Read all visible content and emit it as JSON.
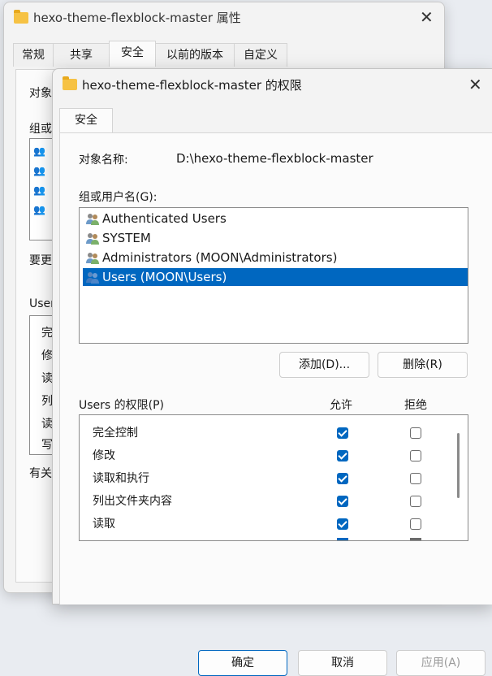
{
  "back_window": {
    "title": "hexo-theme-flexblock-master 属性",
    "tabs": [
      "常规",
      "共享",
      "安全",
      "以前的版本",
      "自定义"
    ],
    "active_tab": 2,
    "fragments": [
      "对象",
      "组或",
      "要更",
      "User",
      "完",
      "修",
      "读",
      "列",
      "读",
      "写",
      "有关"
    ]
  },
  "dialog": {
    "title": "hexo-theme-flexblock-master 的权限",
    "tab": "安全",
    "object_label": "对象名称:",
    "object_value": "D:\\hexo-theme-flexblock-master",
    "group_label": "组或用户名(G):",
    "users": [
      {
        "label": "Authenticated Users",
        "selected": false
      },
      {
        "label": "SYSTEM",
        "selected": false
      },
      {
        "label": "Administrators (MOON\\Administrators)",
        "selected": false
      },
      {
        "label": "Users (MOON\\Users)",
        "selected": true
      }
    ],
    "add_button": "添加(D)...",
    "remove_button": "删除(R)",
    "perm_label": "Users 的权限(P)",
    "allow_header": "允许",
    "deny_header": "拒绝",
    "permissions": [
      {
        "name": "完全控制",
        "allow": true,
        "deny": false
      },
      {
        "name": "修改",
        "allow": true,
        "deny": false
      },
      {
        "name": "读取和执行",
        "allow": true,
        "deny": false
      },
      {
        "name": "列出文件夹内容",
        "allow": true,
        "deny": false
      },
      {
        "name": "读取",
        "allow": true,
        "deny": false
      }
    ],
    "ok_button": "确定",
    "cancel_button": "取消",
    "apply_button": "应用(A)"
  },
  "colors": {
    "accent": "#0067c0",
    "selection": "#0067c0",
    "folder": "#f6c244"
  }
}
